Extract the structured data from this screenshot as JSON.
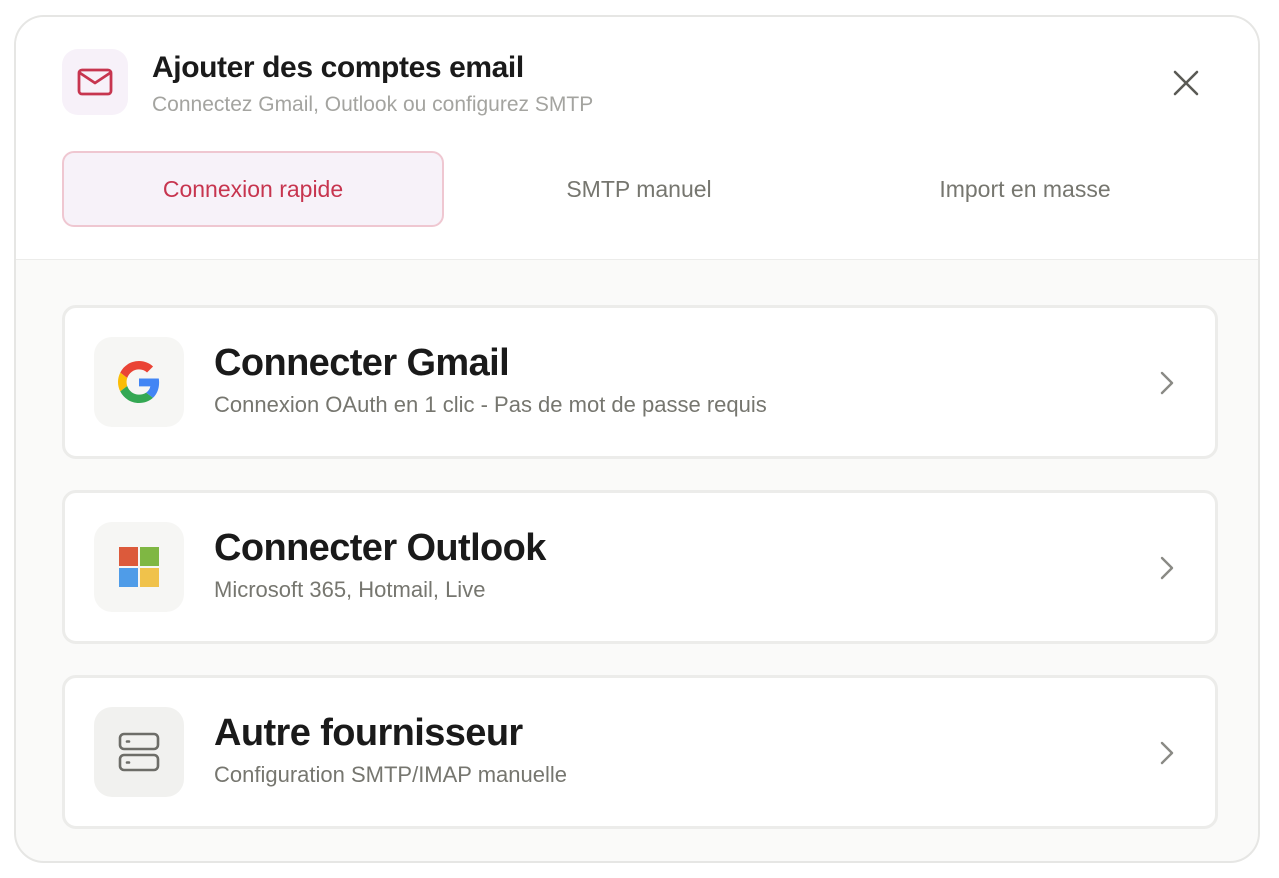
{
  "header": {
    "title": "Ajouter des comptes email",
    "subtitle": "Connectez Gmail, Outlook ou configurez SMTP",
    "icon": "mail-icon",
    "close_icon": "close-icon"
  },
  "tabs": [
    {
      "label": "Connexion rapide",
      "active": true
    },
    {
      "label": "SMTP manuel",
      "active": false
    },
    {
      "label": "Import en masse",
      "active": false
    }
  ],
  "providers": [
    {
      "title": "Connecter Gmail",
      "description": "Connexion OAuth en 1 clic - Pas de mot de passe requis",
      "icon": "google-icon"
    },
    {
      "title": "Connecter Outlook",
      "description": "Microsoft 365, Hotmail, Live",
      "icon": "microsoft-icon"
    },
    {
      "title": "Autre fournisseur",
      "description": "Configuration SMTP/IMAP manuelle",
      "icon": "server-icon"
    }
  ],
  "colors": {
    "accent": "#c7354f",
    "accent_bg": "#f7f2f9",
    "accent_border": "#efc7d1",
    "text_primary": "#1a1a1a",
    "text_muted": "#76766f"
  }
}
